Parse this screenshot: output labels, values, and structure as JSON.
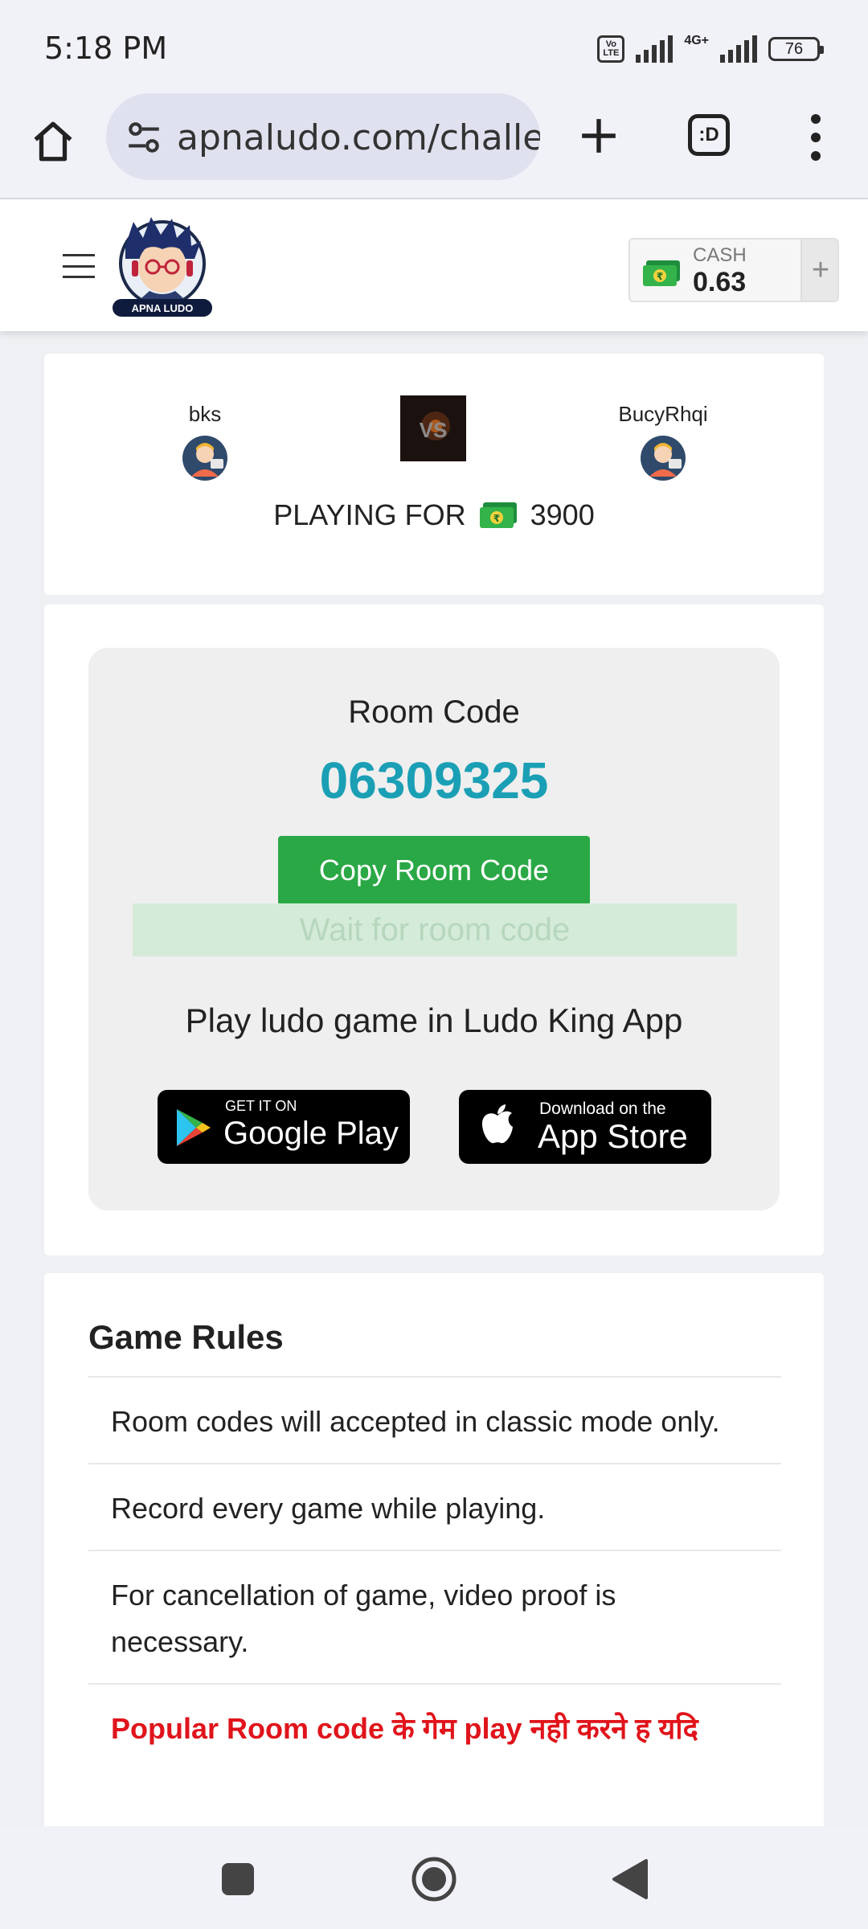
{
  "status_bar": {
    "time": "5:18 PM",
    "volte_label": "Vo LTE",
    "network_label": "4G+",
    "battery": "76"
  },
  "browser": {
    "url": "apnaludo.com/challenge",
    "tabs_label": ":D"
  },
  "header": {
    "logo_text": "APNA LUDO",
    "wallet_label": "CASH",
    "wallet_value": "0.63",
    "add_label": "+"
  },
  "match": {
    "player1": "bks",
    "player2": "BucyRhqi",
    "vs_label": "VS",
    "playing_for_label": "PLAYING FOR",
    "amount": "3900"
  },
  "room": {
    "title": "Room Code",
    "code": "06309325",
    "copy_button": "Copy Room Code",
    "wait_text": "Wait for room code",
    "play_title": "Play ludo game in Ludo King App",
    "google_small": "GET IT ON",
    "google_big": "Google Play",
    "apple_small": "Download on the",
    "apple_big": "App Store"
  },
  "rules": {
    "title": "Game Rules",
    "items": [
      "Room codes will accepted in classic mode only.",
      "Record every game while playing.",
      "For cancellation of game, video proof is necessary.",
      "Popular Room code के गेम play नही करने ह यदि"
    ]
  },
  "colors": {
    "accent_cyan": "#1a9fb5",
    "button_green": "#2aa845",
    "rule_red": "#e0141b"
  }
}
